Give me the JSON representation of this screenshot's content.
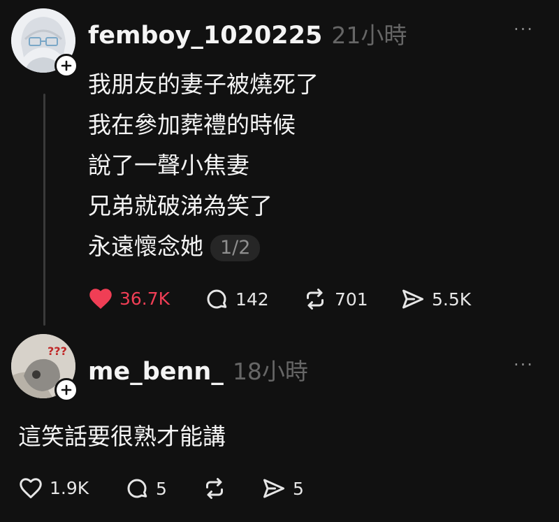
{
  "posts": [
    {
      "username": "femboy_1020225",
      "time": "21小時",
      "more": "···",
      "lines": [
        "我朋友的妻子被燒死了",
        "我在參加葬禮的時候",
        "說了一聲小焦妻",
        "兄弟就破涕為笑了",
        "永遠懷念她"
      ],
      "pager": "1/2",
      "likes": "36.7K",
      "comments": "142",
      "reposts": "701",
      "shares": "5.5K",
      "liked": true
    },
    {
      "username": "me_benn_",
      "time": "18小時",
      "more": "···",
      "text": "這笑話要很熟才能講",
      "likes": "1.9K",
      "comments": "5",
      "reposts": "",
      "shares": "5",
      "liked": false
    }
  ],
  "colors": {
    "background": "#111111",
    "like_active": "#f03e55",
    "muted": "#666666"
  },
  "icons": [
    "avatar",
    "follow-plus-icon",
    "more-icon",
    "heart-icon",
    "comment-icon",
    "repost-icon",
    "share-icon"
  ]
}
